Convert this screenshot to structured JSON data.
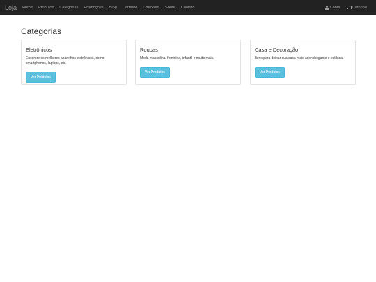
{
  "nav": {
    "brand": "Loja",
    "links": [
      "Home",
      "Produtos",
      "Categorias",
      "Promoções",
      "Blog",
      "Carrinho",
      "Checkout",
      "Sobre",
      "Contato"
    ],
    "account": "Conta",
    "cart": "Carrinho"
  },
  "page": {
    "title": "Categorias"
  },
  "categories": [
    {
      "name": "Eletrônicos",
      "description": "Encontre os melhores aparelhos eletrônicos, como smartphones, laptops, etc.",
      "button": "Ver Produtos"
    },
    {
      "name": "Roupas",
      "description": "Moda masculina, feminina, infantil e muito mais.",
      "button": "Ver Produtos"
    },
    {
      "name": "Casa e Decoração",
      "description": "Itens para deixar sua casa mais aconchegante e estilosa.",
      "button": "Ver Produtos"
    }
  ],
  "colors": {
    "navbar": "#222222",
    "nav_text": "#9d9d9d",
    "button": "#5bc0de"
  }
}
